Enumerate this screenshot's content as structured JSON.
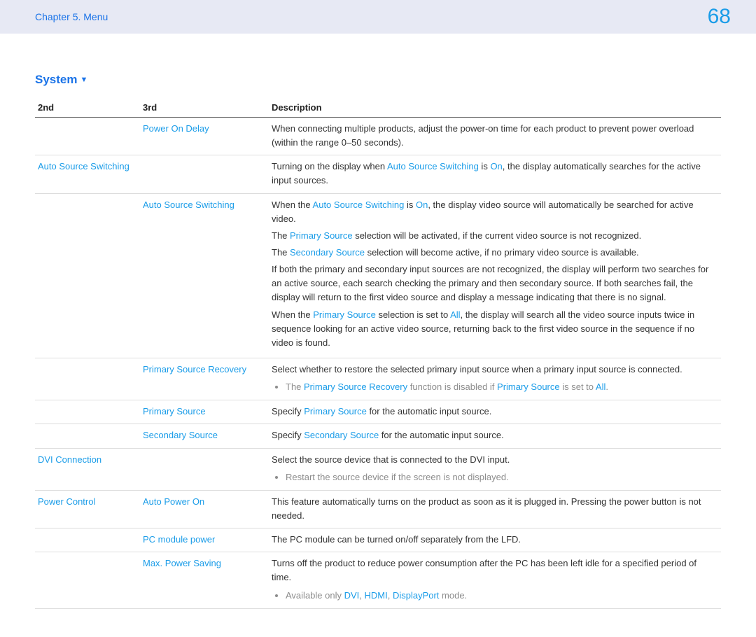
{
  "header": {
    "chapter": "Chapter 5. Menu",
    "page": "68"
  },
  "section_title": "System",
  "table": {
    "headers": {
      "c1": "2nd",
      "c2": "3rd",
      "c3": "Description"
    }
  },
  "rows": {
    "r1": {
      "c2": "Power On Delay",
      "desc_pre": "When connecting multiple products, adjust the power-on time for each product to prevent power overload (within the range 0–50 seconds)."
    },
    "r2": {
      "c1": "Auto Source Switching",
      "desc_p1a": "Turning on the display when ",
      "desc_p1b": "Auto Source Switching",
      "desc_p1c": " is ",
      "desc_p1d": "On",
      "desc_p1e": ", the display automatically searches for the active input sources."
    },
    "r3": {
      "c2": "Auto Source Switching",
      "p1a": "When the ",
      "p1b": "Auto Source Switching",
      "p1c": " is ",
      "p1d": "On",
      "p1e": ", the display video source will automatically be searched for active video.",
      "p2a": "The ",
      "p2b": "Primary Source",
      "p2c": " selection will be activated, if the current video source is not recognized.",
      "p3a": "The ",
      "p3b": "Secondary Source",
      "p3c": " selection will become active, if no primary video source is available.",
      "p4": "If both the primary and secondary input sources are not recognized, the display will perform two searches for an active source, each search checking the primary and then secondary source. If both searches fail, the display will return to the first video source and display a message indicating that there is no signal.",
      "p5a": "When the ",
      "p5b": "Primary Source",
      "p5c": " selection is set to ",
      "p5d": "All",
      "p5e": ", the display will search all the video source inputs twice in sequence looking for an active video source, returning back to the first video source in the sequence if no video is found."
    },
    "r4": {
      "c2": "Primary Source Recovery",
      "p1": "Select whether to restore the selected primary input source when a primary input source is connected.",
      "b1a": "The ",
      "b1b": "Primary Source Recovery",
      "b1c": " function is disabled if ",
      "b1d": "Primary Source",
      "b1e": " is set to ",
      "b1f": "All",
      "b1g": "."
    },
    "r5": {
      "c2": "Primary Source",
      "p1a": "Specify ",
      "p1b": "Primary Source",
      "p1c": " for the automatic input source."
    },
    "r6": {
      "c2": "Secondary Source",
      "p1a": "Specify ",
      "p1b": "Secondary Source",
      "p1c": " for the automatic input source."
    },
    "r7": {
      "c1": "DVI Connection",
      "p1": "Select the source device that is connected to the DVI input.",
      "b1": "Restart the source device if the screen is not displayed."
    },
    "r8": {
      "c1": "Power Control",
      "c2": "Auto Power On",
      "p1": "This feature automatically turns on the product as soon as it is plugged in. Pressing the power button is not needed."
    },
    "r9": {
      "c2": "PC module power",
      "p1": "The PC module can be turned on/off separately from the LFD."
    },
    "r10": {
      "c2": "Max. Power Saving",
      "p1": "Turns off the product to reduce power consumption after the PC has been left idle for a specified period of time.",
      "b1a": "Available only ",
      "b1b": "DVI",
      "b1c": ", ",
      "b1d": "HDMI",
      "b1e": ", ",
      "b1f": "DisplayPort",
      "b1g": " mode."
    }
  }
}
